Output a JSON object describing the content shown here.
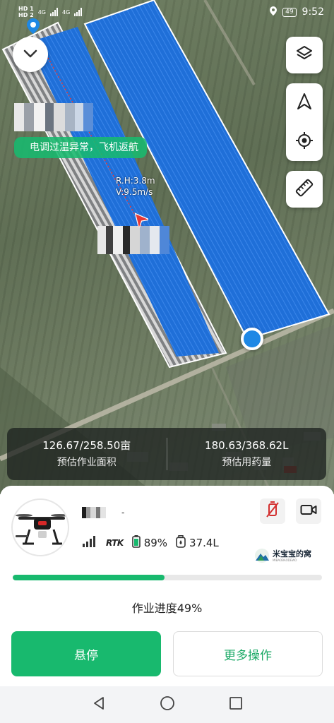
{
  "status_bar": {
    "sim1": "HD 1",
    "sim2": "HD 2",
    "net1": "4G",
    "net2": "4G",
    "battery": "49",
    "time": "9:52"
  },
  "map": {
    "alert_text": "电调过温异常，飞机返航",
    "rh_text": "R.H:3.8m",
    "speed_text": "V:9.5m/s",
    "icons": [
      "chevron-down-icon",
      "layers-icon",
      "navigation-arrow-icon",
      "locate-target-icon",
      "ruler-icon"
    ]
  },
  "stats": {
    "area_value": "126.67/258.50亩",
    "area_label": "预估作业面积",
    "pesticide_value": "180.63/368.62L",
    "pesticide_label": "预估用药量"
  },
  "drone": {
    "name_suffix": "-",
    "rtk_label": "RTK",
    "battery_text": "89%",
    "tank_text": "37.4L"
  },
  "watermark": {
    "text": "米宝宝的窝",
    "subtext": "MIBAOBAODEWO"
  },
  "progress": {
    "value": 0.49,
    "label": "作业进度49%"
  },
  "buttons": {
    "hover": "悬停",
    "more": "更多操作"
  },
  "colors": {
    "accent_green": "#18b96e",
    "field_blue": "#1f6fd8",
    "alert_red": "#e53935"
  }
}
